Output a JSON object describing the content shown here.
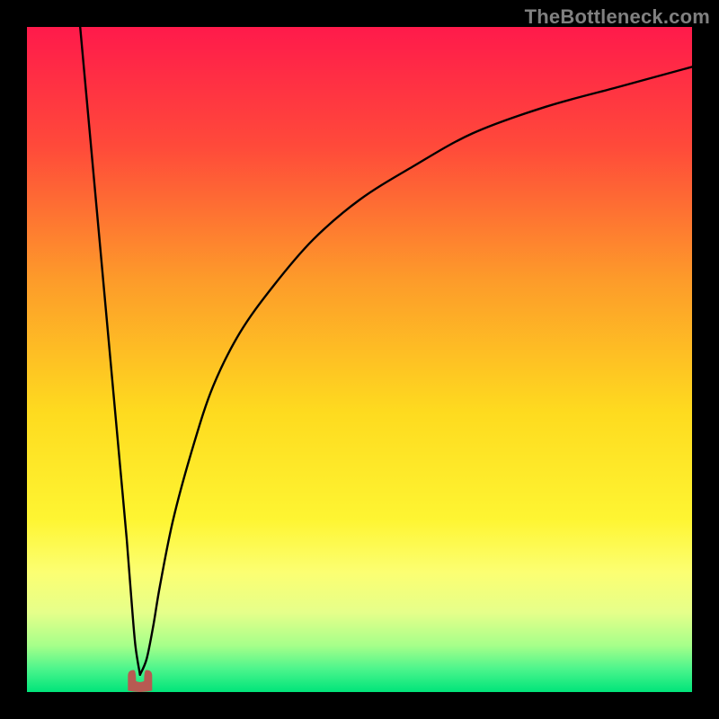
{
  "watermark": "TheBottleneck.com",
  "chart_data": {
    "type": "line",
    "title": "",
    "xlabel": "",
    "ylabel": "",
    "xlim": [
      0,
      100
    ],
    "ylim": [
      0,
      100
    ],
    "background_gradient": {
      "stops": [
        {
          "offset": 0.0,
          "color": "#FF1A4B"
        },
        {
          "offset": 0.18,
          "color": "#FF4A3A"
        },
        {
          "offset": 0.38,
          "color": "#FD9B2A"
        },
        {
          "offset": 0.58,
          "color": "#FEDB1F"
        },
        {
          "offset": 0.74,
          "color": "#FEF532"
        },
        {
          "offset": 0.82,
          "color": "#FCFF72"
        },
        {
          "offset": 0.88,
          "color": "#E6FF8A"
        },
        {
          "offset": 0.93,
          "color": "#A6FF8A"
        },
        {
          "offset": 0.965,
          "color": "#4DF58C"
        },
        {
          "offset": 1.0,
          "color": "#00E47A"
        }
      ]
    },
    "optimum_x": 17,
    "optimum_marker_color": "#B75A52",
    "series": [
      {
        "name": "left-arm",
        "x": [
          8,
          9,
          10,
          11,
          12,
          13,
          14,
          15,
          15.7,
          16.3,
          17
        ],
        "y": [
          100,
          89,
          78,
          67,
          56,
          45,
          34,
          23,
          14,
          7,
          2.6
        ]
      },
      {
        "name": "right-arm",
        "x": [
          17,
          18,
          19,
          20,
          22,
          25,
          28,
          32,
          37,
          43,
          50,
          58,
          67,
          78,
          89,
          100
        ],
        "y": [
          2.6,
          5,
          10,
          16,
          26,
          37,
          46,
          54,
          61,
          68,
          74,
          79,
          84,
          88,
          91,
          94
        ]
      }
    ],
    "grid": false,
    "legend": false
  }
}
